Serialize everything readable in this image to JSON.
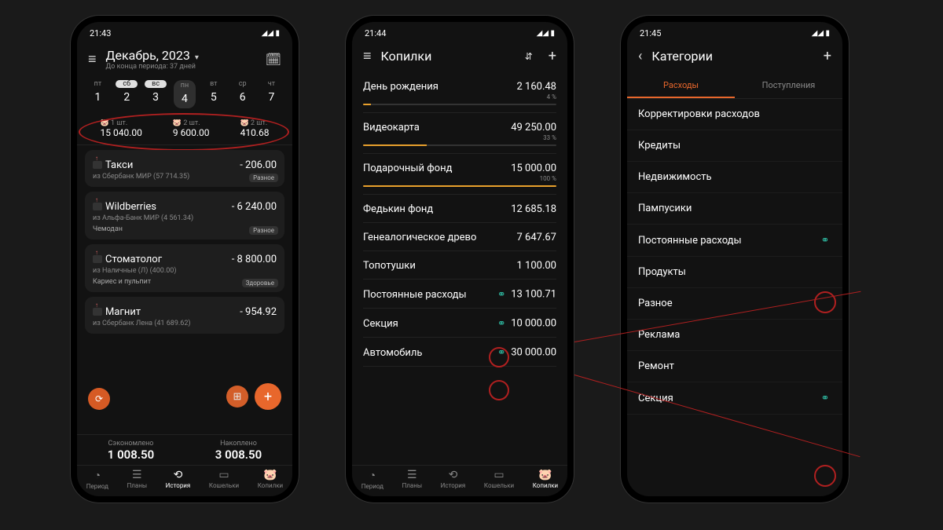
{
  "phone1": {
    "time": "21:43",
    "title": "Декабрь, 2023",
    "subtitle": "До конца периода: 37 дней",
    "days": [
      {
        "name": "пт",
        "num": "1"
      },
      {
        "name": "сб",
        "num": "2",
        "sel": true
      },
      {
        "name": "вс",
        "num": "3",
        "sel": true
      },
      {
        "name": "пн",
        "num": "4",
        "active": true
      },
      {
        "name": "вт",
        "num": "5"
      },
      {
        "name": "ср",
        "num": "6"
      },
      {
        "name": "чт",
        "num": "7"
      }
    ],
    "piggies": [
      {
        "count": "1 шт.",
        "value": "15 040.00"
      },
      {
        "count": "2 шт.",
        "value": "9 600.00"
      },
      {
        "count": "2 шт.",
        "value": "410.68"
      }
    ],
    "txns": [
      {
        "name": "Такси",
        "amount": "- 206.00",
        "sub": "из Сбербанк МИР (57 714.35)",
        "tag": "Разное"
      },
      {
        "name": "Wildberries",
        "amount": "- 6 240.00",
        "sub": "из Альфа-Банк МИР (4 561.34)",
        "note": "Чемодан",
        "tag": "Разное"
      },
      {
        "name": "Стоматолог",
        "amount": "- 8 800.00",
        "sub": "из Наличные (Л) (400.00)",
        "note": "Кариес и пульпит",
        "tag": "Здоровье"
      },
      {
        "name": "Магнит",
        "amount": "- 954.92",
        "sub": "из Сбербанк Лена (41 689.62)"
      }
    ],
    "totals": {
      "saved_label": "Сэкономлено",
      "saved_value": "1 008.50",
      "accum_label": "Накоплено",
      "accum_value": "3 008.50"
    },
    "nav": [
      "Период",
      "Планы",
      "История",
      "Кошельки",
      "Копилки"
    ],
    "nav_active": 2
  },
  "phone2": {
    "time": "21:44",
    "title": "Копилки",
    "jars": [
      {
        "name": "День рождения",
        "value": "2 160.48",
        "pct": "4 %",
        "bar": 4
      },
      {
        "name": "Видеокарта",
        "value": "49 250.00",
        "pct": "33 %",
        "bar": 33
      },
      {
        "name": "Подарочный фонд",
        "value": "15 000.00",
        "pct": "100 %",
        "bar": 100
      },
      {
        "name": "Федькин фонд",
        "value": "12 685.18"
      },
      {
        "name": "Генеалогическое древо",
        "value": "7 647.67"
      },
      {
        "name": "Топотушки",
        "value": "1 100.00"
      },
      {
        "name": "Постоянные расходы",
        "value": "13 100.71",
        "linked": true
      },
      {
        "name": "Секция",
        "value": "10 000.00",
        "linked": true
      },
      {
        "name": "Автомобиль",
        "value": "30 000.00",
        "linked": true
      }
    ],
    "nav": [
      "Период",
      "Планы",
      "История",
      "Кошельки",
      "Копилки"
    ],
    "nav_active": 4
  },
  "phone3": {
    "time": "21:45",
    "title": "Категории",
    "tabs": [
      "Расходы",
      "Поступления"
    ],
    "tab_active": 0,
    "cats": [
      {
        "name": "Корректировки расходов"
      },
      {
        "name": "Кредиты"
      },
      {
        "name": "Недвижимость"
      },
      {
        "name": "Пампусики"
      },
      {
        "name": "Постоянные расходы",
        "linked": true
      },
      {
        "name": "Продукты"
      },
      {
        "name": "Разное"
      },
      {
        "name": "Реклама"
      },
      {
        "name": "Ремонт"
      },
      {
        "name": "Секция",
        "linked": true
      }
    ]
  }
}
